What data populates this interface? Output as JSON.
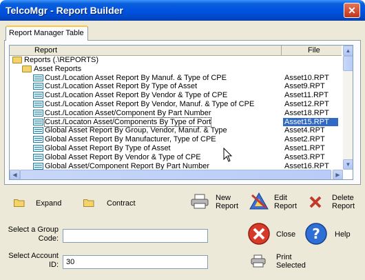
{
  "window": {
    "title": "TelcoMgr - Report Builder",
    "close_glyph": "✕"
  },
  "tab": {
    "label": "Report Manager Table"
  },
  "grid": {
    "headers": {
      "report": "Report",
      "file": "File"
    },
    "rows": [
      {
        "label": "Reports (.\\REPORTS)",
        "file": "",
        "icon": "folder-open-icon",
        "level": 0
      },
      {
        "label": "Asset Reports",
        "file": "",
        "icon": "folder-open-icon",
        "level": 1
      },
      {
        "label": "Cust./Location Asset Report By Manuf. & Type of CPE",
        "file": "Asset10.RPT",
        "icon": "report-icon",
        "level": 2
      },
      {
        "label": "Cust./Location Asset Report By Type of Asset",
        "file": "Asset9.RPT",
        "icon": "report-icon",
        "level": 2
      },
      {
        "label": "Cust./Location Asset Report By Vendor & Type of CPE",
        "file": "Asset11.RPT",
        "icon": "report-icon",
        "level": 2
      },
      {
        "label": "Cust./Location Asset Report By Vendor, Manuf. & Type of CPE",
        "file": "Asset12.RPT",
        "icon": "report-icon",
        "level": 2
      },
      {
        "label": "Cust./Location Asset/Component By Part Number",
        "file": "Asset18.RPT",
        "icon": "report-icon",
        "level": 2
      },
      {
        "label": "Cust./Locaton Asset/Components By Type of Port",
        "file": "Asset15.RPT",
        "icon": "report-icon",
        "level": 2,
        "selected": true
      },
      {
        "label": "Global Asset Report By Group, Vendor, Manuf. & Type",
        "file": "Asset4.RPT",
        "icon": "report-icon",
        "level": 2
      },
      {
        "label": "Global Asset Report By Manufacturer, Type of CPE",
        "file": "Asset2.RPT",
        "icon": "report-icon",
        "level": 2
      },
      {
        "label": "Global Asset Report By Type of Asset",
        "file": "Asset1.RPT",
        "icon": "report-icon",
        "level": 2
      },
      {
        "label": "Global Asset Report By Vendor & Type of CPE",
        "file": "Asset3.RPT",
        "icon": "report-icon",
        "level": 2
      },
      {
        "label": "Global Asset/Component Report By Part Number",
        "file": "Asset16.RPT",
        "icon": "report-icon",
        "level": 2
      }
    ]
  },
  "actions": {
    "expand": "Expand",
    "contract": "Contract",
    "new_report_1": "New",
    "new_report_2": "Report",
    "edit_report_1": "Edit",
    "edit_report_2": "Report",
    "delete_report_1": "Delete",
    "delete_report_2": "Report",
    "close": "Close",
    "help": "Help",
    "print_1": "Print",
    "print_2": "Selected"
  },
  "form": {
    "group_code_label_1": "Select a Group",
    "group_code_label_2": "Code:",
    "group_code_value": "",
    "account_id_label_1": "Select Account",
    "account_id_label_2": "ID:",
    "account_id_value": "30"
  },
  "colors": {
    "title_bar": "#0054e3",
    "selection": "#316ac5",
    "tab_highlight": "#ffc83c"
  }
}
